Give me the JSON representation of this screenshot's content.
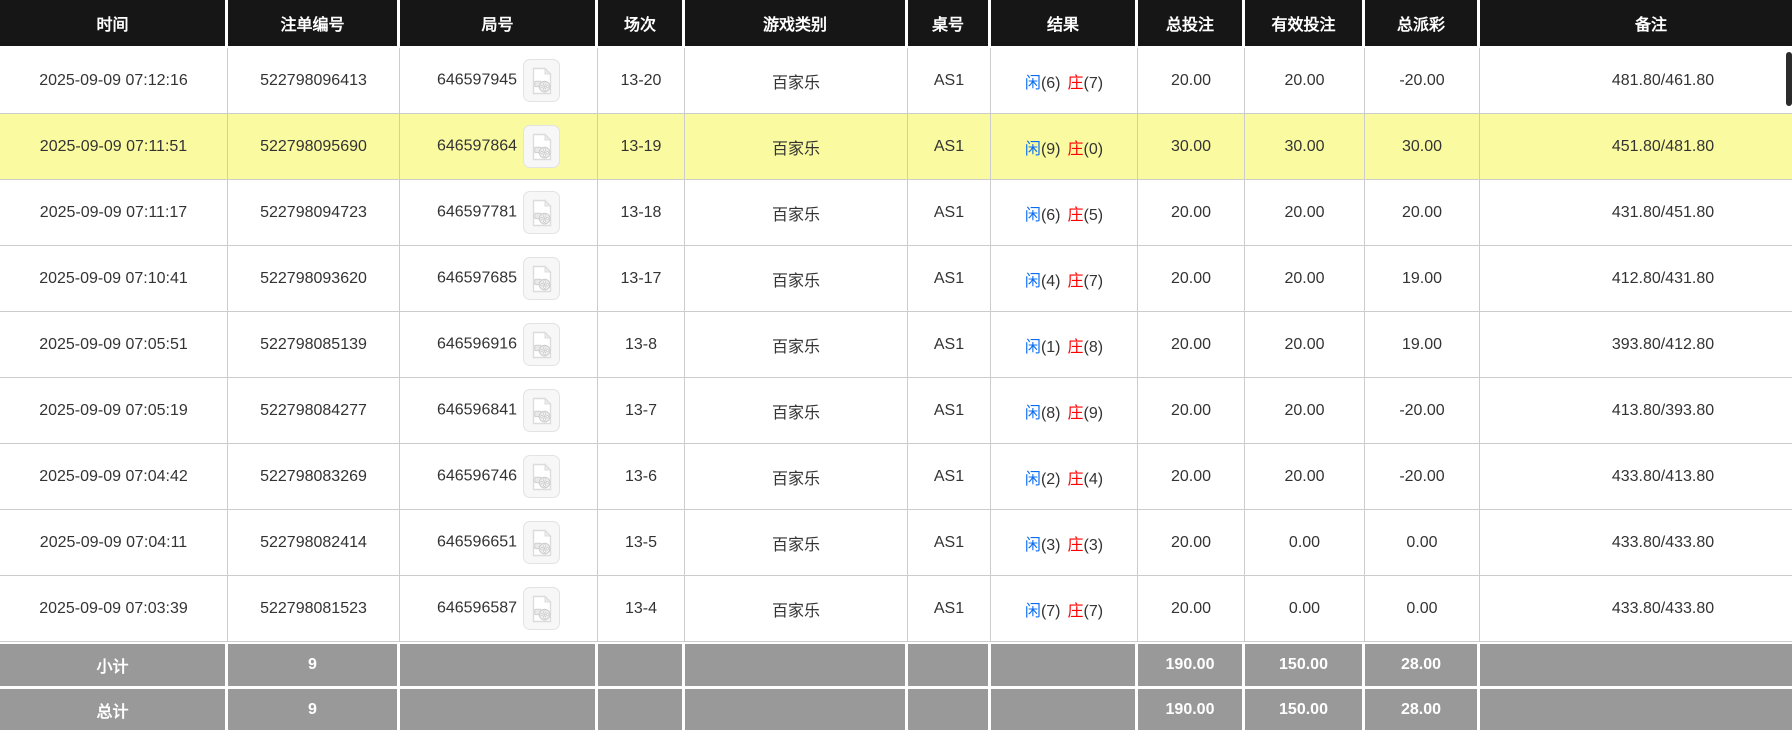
{
  "table": {
    "columns": [
      {
        "label": "时间"
      },
      {
        "label": "注单编号"
      },
      {
        "label": "局号"
      },
      {
        "label": "场次"
      },
      {
        "label": "游戏类别"
      },
      {
        "label": "桌号"
      },
      {
        "label": "结果"
      },
      {
        "label": "总投注"
      },
      {
        "label": "有效投注"
      },
      {
        "label": "总派彩"
      },
      {
        "label": "备注"
      }
    ],
    "rows": [
      {
        "time": "2025-09-09 07:12:16",
        "bet_no": "522798096413",
        "round_no": "646597945",
        "session": "13-20",
        "game_type": "百家乐",
        "table_no": "AS1",
        "result": {
          "p": "闲",
          "pn": "(6)",
          "b": "庄",
          "bn": "(7)"
        },
        "total_bet": "20.00",
        "valid_bet": "20.00",
        "payout": "-20.00",
        "remark": "481.80/461.80",
        "highlighted": false
      },
      {
        "time": "2025-09-09 07:11:51",
        "bet_no": "522798095690",
        "round_no": "646597864",
        "session": "13-19",
        "game_type": "百家乐",
        "table_no": "AS1",
        "result": {
          "p": "闲",
          "pn": "(9)",
          "b": "庄",
          "bn": "(0)"
        },
        "total_bet": "30.00",
        "valid_bet": "30.00",
        "payout": "30.00",
        "remark": "451.80/481.80",
        "highlighted": true
      },
      {
        "time": "2025-09-09 07:11:17",
        "bet_no": "522798094723",
        "round_no": "646597781",
        "session": "13-18",
        "game_type": "百家乐",
        "table_no": "AS1",
        "result": {
          "p": "闲",
          "pn": "(6)",
          "b": "庄",
          "bn": "(5)"
        },
        "total_bet": "20.00",
        "valid_bet": "20.00",
        "payout": "20.00",
        "remark": "431.80/451.80",
        "highlighted": false
      },
      {
        "time": "2025-09-09 07:10:41",
        "bet_no": "522798093620",
        "round_no": "646597685",
        "session": "13-17",
        "game_type": "百家乐",
        "table_no": "AS1",
        "result": {
          "p": "闲",
          "pn": "(4)",
          "b": "庄",
          "bn": "(7)"
        },
        "total_bet": "20.00",
        "valid_bet": "20.00",
        "payout": "19.00",
        "remark": "412.80/431.80",
        "highlighted": false
      },
      {
        "time": "2025-09-09 07:05:51",
        "bet_no": "522798085139",
        "round_no": "646596916",
        "session": "13-8",
        "game_type": "百家乐",
        "table_no": "AS1",
        "result": {
          "p": "闲",
          "pn": "(1)",
          "b": "庄",
          "bn": "(8)"
        },
        "total_bet": "20.00",
        "valid_bet": "20.00",
        "payout": "19.00",
        "remark": "393.80/412.80",
        "highlighted": false
      },
      {
        "time": "2025-09-09 07:05:19",
        "bet_no": "522798084277",
        "round_no": "646596841",
        "session": "13-7",
        "game_type": "百家乐",
        "table_no": "AS1",
        "result": {
          "p": "闲",
          "pn": "(8)",
          "b": "庄",
          "bn": "(9)"
        },
        "total_bet": "20.00",
        "valid_bet": "20.00",
        "payout": "-20.00",
        "remark": "413.80/393.80",
        "highlighted": false
      },
      {
        "time": "2025-09-09 07:04:42",
        "bet_no": "522798083269",
        "round_no": "646596746",
        "session": "13-6",
        "game_type": "百家乐",
        "table_no": "AS1",
        "result": {
          "p": "闲",
          "pn": "(2)",
          "b": "庄",
          "bn": "(4)"
        },
        "total_bet": "20.00",
        "valid_bet": "20.00",
        "payout": "-20.00",
        "remark": "433.80/413.80",
        "highlighted": false
      },
      {
        "time": "2025-09-09 07:04:11",
        "bet_no": "522798082414",
        "round_no": "646596651",
        "session": "13-5",
        "game_type": "百家乐",
        "table_no": "AS1",
        "result": {
          "p": "闲",
          "pn": "(3)",
          "b": "庄",
          "bn": "(3)"
        },
        "total_bet": "20.00",
        "valid_bet": "0.00",
        "payout": "0.00",
        "remark": "433.80/433.80",
        "highlighted": false
      },
      {
        "time": "2025-09-09 07:03:39",
        "bet_no": "522798081523",
        "round_no": "646596587",
        "session": "13-4",
        "game_type": "百家乐",
        "table_no": "AS1",
        "result": {
          "p": "闲",
          "pn": "(7)",
          "b": "庄",
          "bn": "(7)"
        },
        "total_bet": "20.00",
        "valid_bet": "0.00",
        "payout": "0.00",
        "remark": "433.80/433.80",
        "highlighted": false
      }
    ],
    "footer": [
      {
        "label": "小计",
        "count": "9",
        "total_bet": "190.00",
        "valid_bet": "150.00",
        "payout": "28.00"
      },
      {
        "label": "总计",
        "count": "9",
        "total_bet": "190.00",
        "valid_bet": "150.00",
        "payout": "28.00"
      }
    ]
  },
  "icons": {
    "video_icon": "video-replay-icon"
  },
  "colors": {
    "header_bg": "#161616",
    "header_text": "#ffffff",
    "highlight_row": "#fafaa0",
    "footer_bg": "#999999",
    "bet_blue": "#0a6cf5",
    "player_blue": "#0a6cf5",
    "banker_red": "#ff0000",
    "loss_red": "#ff0000",
    "body_text": "#333333",
    "grid_line": "#cccccc"
  }
}
